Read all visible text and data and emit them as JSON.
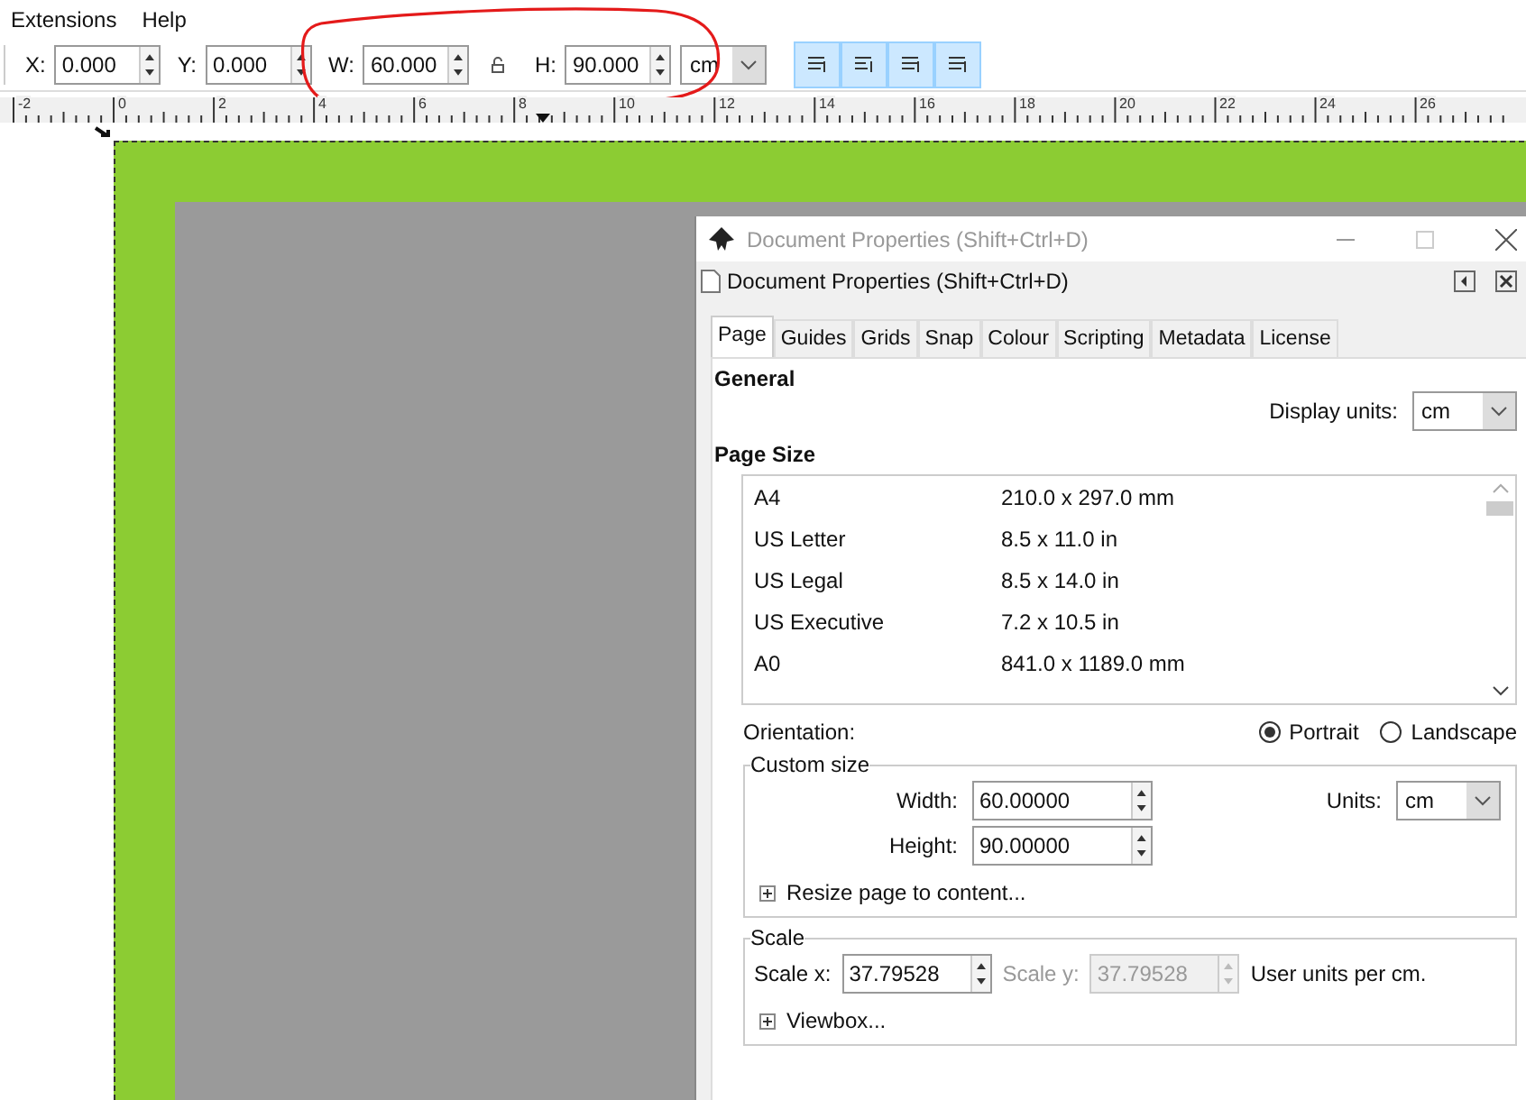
{
  "menu": [
    "Extensions",
    "Help"
  ],
  "toolbar": {
    "fields": [
      {
        "label": "X:",
        "value": "0.000"
      },
      {
        "label": "Y:",
        "value": "0.000"
      },
      {
        "label": "W:",
        "value": "60.000"
      },
      {
        "label": "H:",
        "value": "90.000"
      }
    ],
    "unit": "cm",
    "snap_buttons": [
      {
        "on": true
      },
      {
        "on": true
      },
      {
        "on": true
      },
      {
        "on": true
      }
    ]
  },
  "ruler": {
    "labels": [
      "-2",
      "0",
      "2",
      "4",
      "6",
      "8",
      "10",
      "12",
      "14",
      "16",
      "18",
      "20",
      "22",
      "24",
      "26"
    ]
  },
  "dialog": {
    "window_title": "Document Properties (Shift+Ctrl+D)",
    "panel_title": "Document Properties (Shift+Ctrl+D)",
    "tabs": [
      {
        "label": "Page",
        "selected": true
      },
      {
        "label": "Guides",
        "selected": false
      },
      {
        "label": "Grids",
        "selected": false
      },
      {
        "label": "Snap",
        "selected": false
      },
      {
        "label": "Colour",
        "selected": false
      },
      {
        "label": "Scripting",
        "selected": false
      },
      {
        "label": "Metadata",
        "selected": false
      },
      {
        "label": "License",
        "selected": false
      }
    ],
    "general_heading": "General",
    "display_units_label": "Display units:",
    "display_units_value": "cm",
    "page_size_heading": "Page Size",
    "page_sizes": [
      {
        "name": "A4",
        "size": "210.0 x 297.0 mm"
      },
      {
        "name": "US Letter",
        "size": "8.5 x 11.0 in"
      },
      {
        "name": "US Legal",
        "size": "8.5 x 14.0 in"
      },
      {
        "name": "US Executive",
        "size": "7.2 x 10.5 in"
      },
      {
        "name": "A0",
        "size": "841.0 x 1189.0 mm"
      }
    ],
    "orientation_label": "Orientation:",
    "orientations": [
      {
        "label": "Portrait",
        "selected": true
      },
      {
        "label": "Landscape",
        "selected": false
      }
    ],
    "custom_size": {
      "title": "Custom size",
      "width_label": "Width:",
      "width_value": "60.00000",
      "height_label": "Height:",
      "height_value": "90.00000",
      "units_label": "Units:",
      "units_value": "cm",
      "resize_label": "Resize page to content..."
    },
    "scale": {
      "title": "Scale",
      "x_label": "Scale x:",
      "x_value": "37.79528",
      "y_label": "Scale y:",
      "y_value": "37.79528",
      "y_disabled": true,
      "units_text": "User units per cm.",
      "viewbox_label": "Viewbox..."
    }
  }
}
